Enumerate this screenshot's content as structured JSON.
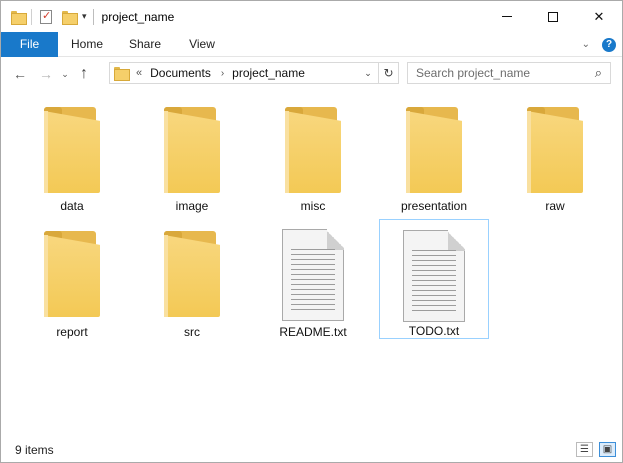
{
  "window": {
    "title": "project_name",
    "controls": {
      "minimize": "",
      "maximize": "",
      "close": "✕"
    }
  },
  "quick_access": {
    "dropdown": "▾"
  },
  "ribbon": {
    "tabs": [
      "File",
      "Home",
      "Share",
      "View"
    ],
    "expand_icon": "⌄",
    "help_icon": "?"
  },
  "nav": {
    "back": "←",
    "forward": "→",
    "recent": "⌄",
    "up": "↑"
  },
  "address": {
    "overflow": "«",
    "crumbs": [
      "Documents",
      "project_name"
    ],
    "separator": "›",
    "dropdown": "⌄",
    "refresh": "↻"
  },
  "search": {
    "placeholder": "Search project_name",
    "icon": "⌕"
  },
  "items": [
    {
      "name": "data",
      "type": "folder"
    },
    {
      "name": "image",
      "type": "folder"
    },
    {
      "name": "misc",
      "type": "folder"
    },
    {
      "name": "presentation",
      "type": "folder"
    },
    {
      "name": "raw",
      "type": "folder"
    },
    {
      "name": "report",
      "type": "folder"
    },
    {
      "name": "src",
      "type": "folder"
    },
    {
      "name": "README.txt",
      "type": "text-file"
    },
    {
      "name": "TODO.txt",
      "type": "text-file",
      "selected": true
    }
  ],
  "status": {
    "count": "9 items",
    "view_details": "☰",
    "view_icons": "▣"
  },
  "colors": {
    "accent": "#1979ca",
    "folder": "#f5cf6a",
    "selection_border": "#99d1ff"
  }
}
